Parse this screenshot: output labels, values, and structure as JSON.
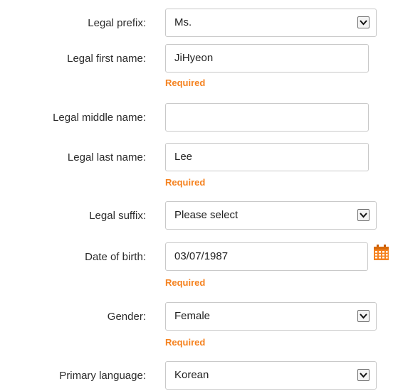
{
  "form": {
    "required_text": "Required",
    "fields": {
      "legal_prefix": {
        "label": "Legal prefix:",
        "value": "Ms.",
        "type": "select"
      },
      "legal_first_name": {
        "label": "Legal first name:",
        "value": "JiHyeon",
        "type": "text"
      },
      "legal_middle_name": {
        "label": "Legal middle name:",
        "value": "",
        "type": "text"
      },
      "legal_last_name": {
        "label": "Legal last name:",
        "value": "Lee",
        "type": "text"
      },
      "legal_suffix": {
        "label": "Legal suffix:",
        "value": "Please select",
        "type": "select"
      },
      "date_of_birth": {
        "label": "Date of birth:",
        "value": "03/07/1987",
        "type": "date"
      },
      "gender": {
        "label": "Gender:",
        "value": "Female",
        "type": "select"
      },
      "primary_language": {
        "label": "Primary language:",
        "value": "Korean",
        "type": "select"
      }
    }
  },
  "icons": {
    "dropdown": "chevron-down-icon",
    "calendar": "calendar-icon"
  },
  "colors": {
    "required": "#f5821f",
    "field_border": "#c9c9c9",
    "label_text": "#2b2b2b",
    "calendar_icon": "#f5821f"
  }
}
